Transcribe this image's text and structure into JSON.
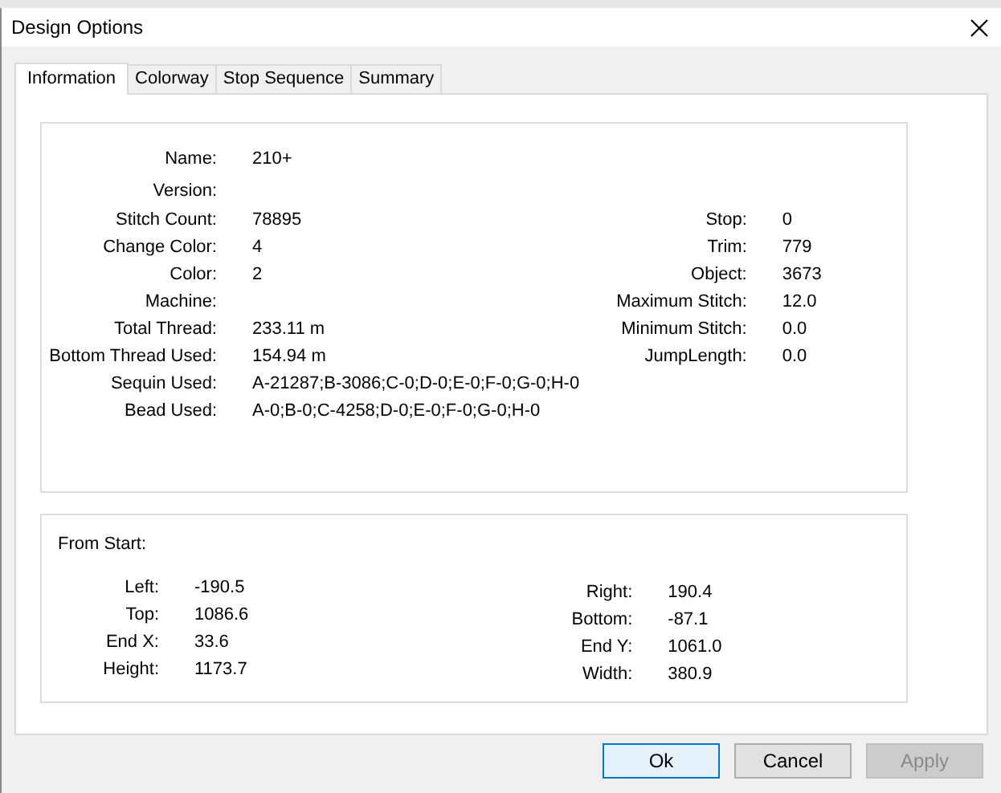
{
  "window": {
    "title": "Design Options"
  },
  "tabs": [
    {
      "label": "Information",
      "selected": true
    },
    {
      "label": "Colorway",
      "selected": false
    },
    {
      "label": "Stop Sequence",
      "selected": false
    },
    {
      "label": "Summary",
      "selected": false
    }
  ],
  "information": {
    "left_fields": [
      {
        "label": "Name:",
        "value": "210+"
      },
      {
        "label": "Version:"
      },
      {
        "label": "Stitch Count:",
        "value": "78895"
      },
      {
        "label": "Change Color:",
        "value": "4"
      },
      {
        "label": "Color:",
        "value": "2"
      },
      {
        "label": "Machine:"
      },
      {
        "label": "Total Thread:",
        "value": "233.11 m"
      },
      {
        "label": "Bottom Thread Used:",
        "value": "154.94 m"
      },
      {
        "label": "Sequin Used:",
        "value": "A-21287;B-3086;C-0;D-0;E-0;F-0;G-0;H-0"
      },
      {
        "label": "Bead Used:",
        "value": "A-0;B-0;C-4258;D-0;E-0;F-0;G-0;H-0"
      }
    ],
    "right_fields": [
      {
        "label": "Stop:",
        "value": "0"
      },
      {
        "label": "Trim:",
        "value": "779"
      },
      {
        "label": "Object:",
        "value": "3673"
      },
      {
        "label": "Maximum Stitch:",
        "value": "12.0"
      },
      {
        "label": "Minimum Stitch:",
        "value": "0.0"
      },
      {
        "label": "JumpLength:",
        "value": "0.0"
      }
    ]
  },
  "from_start": {
    "title": "From Start:",
    "left_fields": [
      {
        "label": "Left:",
        "value": "-190.5"
      },
      {
        "label": "Top:",
        "value": "1086.6"
      },
      {
        "label": "End X:",
        "value": "33.6"
      },
      {
        "label": "Height:",
        "value": "1173.7"
      }
    ],
    "right_fields": [
      {
        "label": "Right:",
        "value": "190.4"
      },
      {
        "label": "Bottom:",
        "value": "-87.1"
      },
      {
        "label": "End Y:",
        "value": "1061.0"
      },
      {
        "label": "Width:",
        "value": "380.9"
      }
    ]
  },
  "buttons": [
    {
      "label": "Ok",
      "default": true,
      "disabled": false
    },
    {
      "label": "Cancel",
      "default": false,
      "disabled": false
    },
    {
      "label": "Apply",
      "default": false,
      "disabled": true
    }
  ]
}
